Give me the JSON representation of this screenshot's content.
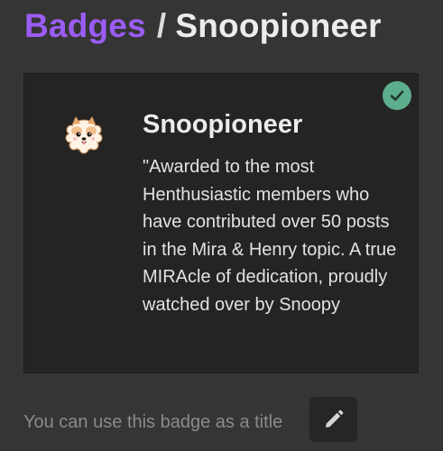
{
  "header": {
    "breadcrumb_link": "Badges",
    "separator": "/",
    "current": "Snoopioneer"
  },
  "badge": {
    "name": "Snoopioneer",
    "description": "\"Awarded to the most Henthusiastic members who have contributed over 50 posts in the Mira & Henry topic. A true MIRAcle of dedication, proudly watched over by Snoopy",
    "icon": "pomeranian-dog-icon",
    "granted_icon": "check-icon",
    "granted_color": "#5cae8c"
  },
  "footer": {
    "title_hint": "You can use this badge as a title",
    "edit_icon": "pencil-icon"
  },
  "colors": {
    "accent": "#9b5cf3",
    "background": "#353535",
    "card": "#242424"
  }
}
